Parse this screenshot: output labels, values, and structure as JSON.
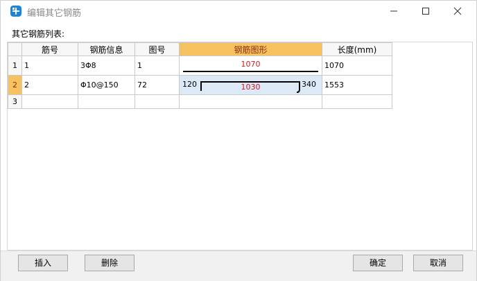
{
  "window": {
    "title": "编辑其它钢筋"
  },
  "section_label": "其它钢筋列表:",
  "table": {
    "columns": [
      "",
      "筋号",
      "钢筋信息",
      "图号",
      "钢筋图形",
      "长度(mm)"
    ],
    "rows": [
      {
        "num": "1",
        "bar_no": "1",
        "info": "3Φ8",
        "figure_no": "1",
        "shape_dim": "1070",
        "length": "1070"
      },
      {
        "num": "2",
        "bar_no": "2",
        "info": "Φ10@150",
        "figure_no": "72",
        "shape_left": "120",
        "shape_main": "1030",
        "shape_right": "340",
        "length": "1553"
      },
      {
        "num": "3",
        "bar_no": "",
        "info": "",
        "figure_no": "",
        "length": ""
      }
    ]
  },
  "buttons": {
    "insert": "插入",
    "delete": "删除",
    "ok": "确定",
    "cancel": "取消"
  },
  "colors": {
    "selected_header": "#f6c25f",
    "active_cell": "#dceaf7",
    "dimension_text": "#d21a1a"
  }
}
